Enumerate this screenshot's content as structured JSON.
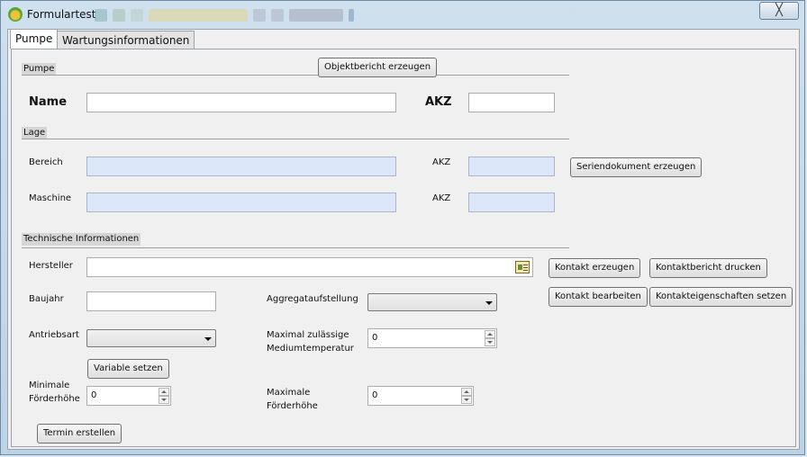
{
  "window": {
    "title": "Formulartest",
    "close_symbol": "╳"
  },
  "tabs": [
    {
      "label": "Pumpe",
      "active": true
    },
    {
      "label": "Wartungsinformationen",
      "active": false
    }
  ],
  "section_pumpe": {
    "header": "Pumpe",
    "report_button": "Objektbericht erzeugen",
    "name_label": "Name",
    "name_value": "",
    "akz_label": "AKZ",
    "akz_value": ""
  },
  "section_lage": {
    "header": "Lage",
    "bereich_label": "Bereich",
    "bereich_value": "",
    "bereich_akz_label": "AKZ",
    "bereich_akz_value": "",
    "serial_doc_button": "Seriendokument erzeugen",
    "maschine_label": "Maschine",
    "maschine_value": "",
    "maschine_akz_label": "AKZ",
    "maschine_akz_value": ""
  },
  "section_tech": {
    "header": "Technische Informationen",
    "hersteller_label": "Hersteller",
    "hersteller_value": "",
    "contact_create_button": "Kontakt erzeugen",
    "contact_report_button": "Kontaktbericht drucken",
    "contact_edit_button": "Kontakt bearbeiten",
    "contact_props_button": "Kontakteigenschaften setzen",
    "baujahr_label": "Baujahr",
    "baujahr_value": "",
    "aggregat_label": "Aggregataufstellung",
    "aggregat_selected": "",
    "antrieb_label": "Antriebsart",
    "antrieb_selected": "",
    "max_temp_label_1": "Maximal zulässige",
    "max_temp_label_2": "Mediumtemperatur",
    "max_temp_value": "0",
    "variable_button": "Variable setzen",
    "min_head_label_1": "Minimale",
    "min_head_label_2": "Förderhöhe",
    "min_head_value": "0",
    "max_head_label_1": "Maximale",
    "max_head_label_2": "Förderhöhe",
    "max_head_value": "0",
    "appointment_button": "Termin erstellen"
  },
  "icons": {
    "app": "app-icon",
    "contact_card": "contact-card-icon",
    "dropdown": "chevron-down-icon",
    "spin_up": "spin-up-icon",
    "spin_down": "spin-down-icon"
  }
}
